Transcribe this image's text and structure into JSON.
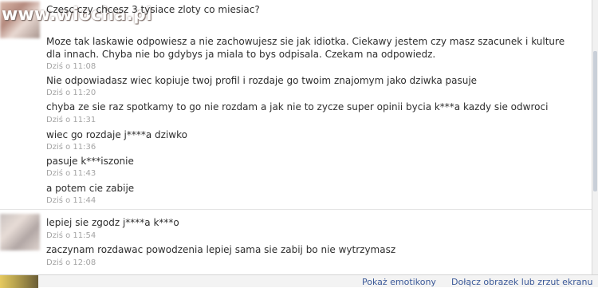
{
  "watermark": "www.wiocha.pl",
  "conversation": {
    "messages": [
      {
        "text": "Czesc czy chcesz 3 tysiace zloty co miesiac?",
        "time": ""
      },
      {
        "text": "Moze tak laskawie odpowiesz a nie zachowujesz sie jak idiotka. Ciekawy jestem czy masz szacunek i kulture dla innach. Chyba nie bo gdybys ja miala to bys odpisala. Czekam na odpowiedz.",
        "time": "Dziś o 11:08"
      },
      {
        "text": "Nie odpowiadasz wiec kopiuje twoj profil i rozdaje go twoim znajomym jako dziwka pasuje",
        "time": "Dziś o 11:20"
      },
      {
        "text": "chyba ze sie raz spotkamy to go nie rozdam a jak nie to zycze super opinii bycia k***a kazdy sie odwroci",
        "time": "Dziś o 11:31"
      },
      {
        "text": "wiec go rozdaje j****a dziwko",
        "time": "Dziś o 11:36"
      },
      {
        "text": "pasuje k***iszonie",
        "time": "Dziś o 11:43"
      },
      {
        "text": "a potem cie zabije",
        "time": "Dziś o 11:44"
      },
      {
        "text": "lepiej sie zgodz j****a k***o",
        "time": "Dziś o 11:54"
      },
      {
        "text": "zaczynam rozdawac powodzenia lepiej sama sie zabij bo nie wytrzymasz",
        "time": "Dziś o 12:08"
      }
    ]
  },
  "footer": {
    "emoticons_link": "Pokaż emotikony",
    "attach_link": "Dołącz obrazek lub zrzut ekranu"
  }
}
